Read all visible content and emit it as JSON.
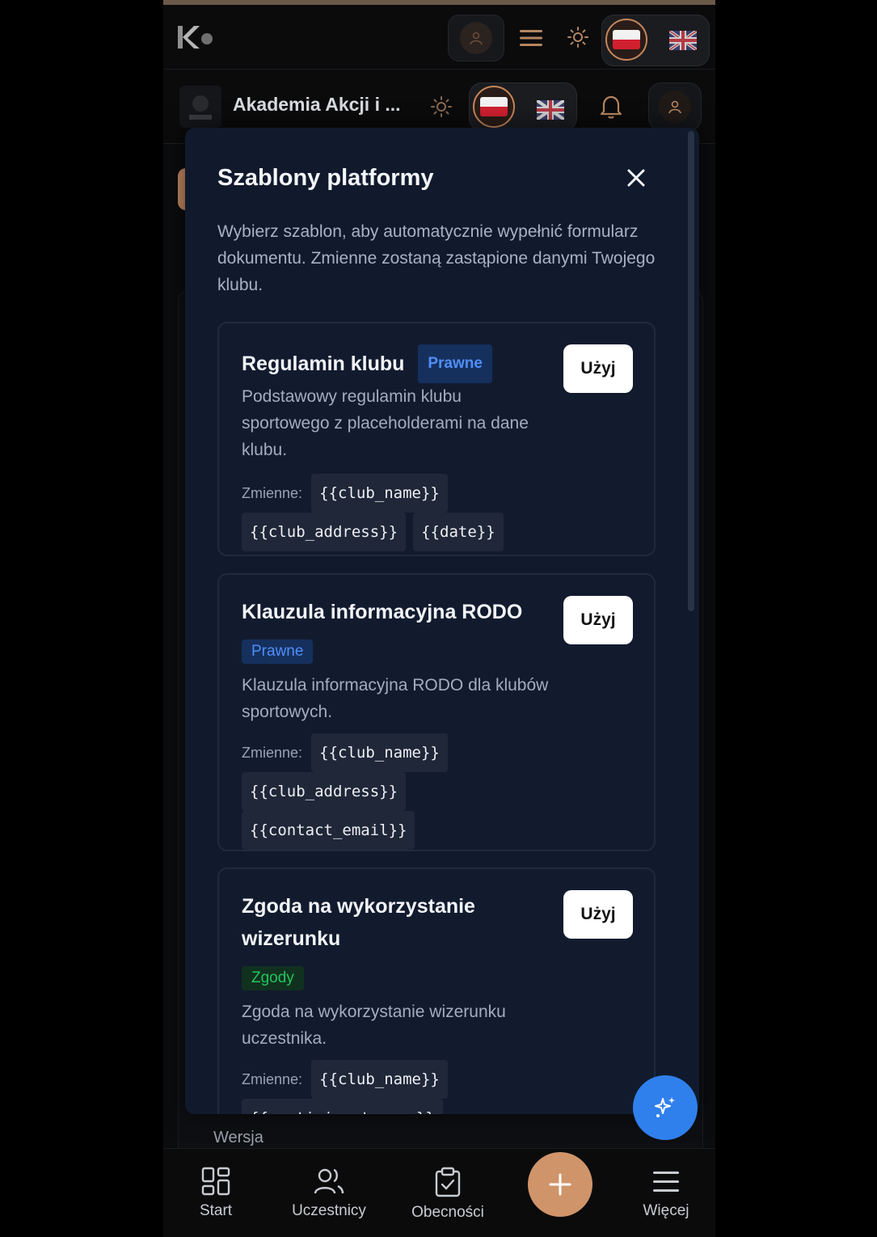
{
  "header": {
    "logo_text": "K"
  },
  "club_header": {
    "club_name": "Akademia Akcji i ..."
  },
  "modal": {
    "title": "Szablony platformy",
    "description": "Wybierz szablon, aby automatycznie wypełnić formularz dokumentu. Zmienne zostaną zastąpione danymi Twojego klubu.",
    "templates": [
      {
        "title": "Regulamin klubu",
        "badge": "Prawne",
        "description": "Podstawowy regulamin klubu sportowego z placeholderami na dane klubu.",
        "vars_label": "Zmienne:",
        "variables": [
          "{{club_name}}",
          "{{club_address}}",
          "{{date}}"
        ],
        "button": "Użyj"
      },
      {
        "title": "Klauzula informacyjna RODO",
        "badge": "Prawne",
        "description": "Klauzula informacyjna RODO dla klubów sportowych.",
        "vars_label": "Zmienne:",
        "variables": [
          "{{club_name}}",
          "{{club_address}}",
          "{{contact_email}}"
        ],
        "button": "Użyj"
      },
      {
        "title_line1": "Zgoda na wykorzystanie",
        "title_line2": "wizerunku",
        "badge": "Zgody",
        "description": "Zgoda na wykorzystanie wizerunku uczestnika.",
        "vars_label": "Zmienne:",
        "variables": [
          "{{club_name}}",
          "{{participant_name}}"
        ],
        "button": "Użyj"
      }
    ]
  },
  "background": {
    "version_label": "Wersja"
  },
  "bottom_nav": {
    "items": [
      {
        "label": "Start",
        "icon": "grid-icon"
      },
      {
        "label": "Uczestnicy",
        "icon": "users-icon"
      },
      {
        "label": "Obecności",
        "icon": "clipboard-check-icon"
      },
      {
        "label": "Więcej",
        "icon": "menu-icon"
      }
    ]
  },
  "colors": {
    "accent": "#d0946a",
    "ai_fab": "#2f80ed",
    "modal_bg": "#111a2d",
    "badge_legal": "#4f8ff7",
    "badge_consent": "#22c55e"
  }
}
